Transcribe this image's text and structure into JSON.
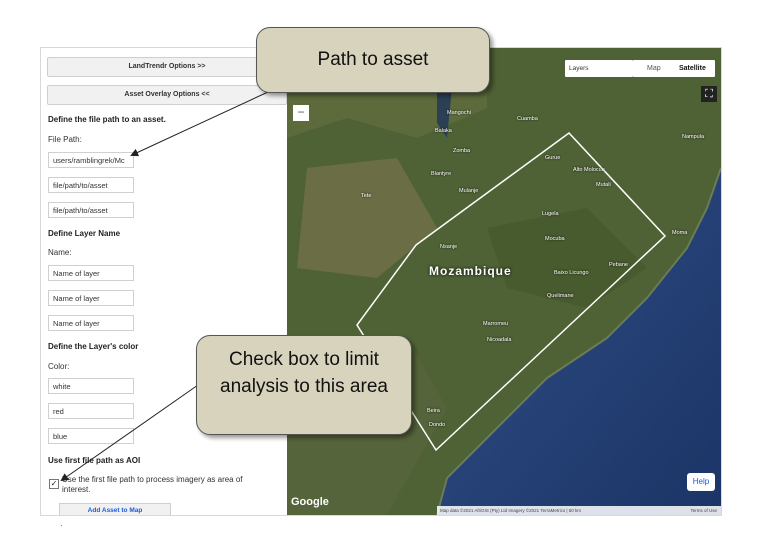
{
  "panel": {
    "landtrendr_button": "LandTrendr Options >>",
    "asset_overlay_button": "Asset Overlay Options <<",
    "file_path_heading": "Define the file path to an asset.",
    "file_path_label": "File Path:",
    "file_paths": [
      "users/ramblingrek/Mc",
      "file/path/to/asset",
      "file/path/to/asset"
    ],
    "layer_name_heading": "Define Layer Name",
    "name_label": "Name:",
    "layer_names": [
      "Name of layer",
      "Name of layer",
      "Name of layer"
    ],
    "color_heading": "Define the Layer's color",
    "color_label": "Color:",
    "colors": [
      "white",
      "red",
      "blue"
    ],
    "aoi_heading": "Use first file path as AOI",
    "aoi_checkbox_label": "Use the first file path to process imagery as area of interest.",
    "aoi_checked": true,
    "add_asset_button": "Add Asset to Map"
  },
  "map": {
    "layers_label": "Layers",
    "map_type_map": "Map",
    "map_type_satellite": "Satellite",
    "zoom_out": "−",
    "fullscreen": "⛶",
    "help": "Help",
    "google": "Google",
    "attribution": "Map data ©2021 AfriGIS (Pty) Ltd Imagery ©2021 TerraMetrics | 50 km",
    "terms": "Terms of Use",
    "country_label": "Mozambique",
    "places": [
      "Cuamba",
      "Mangochi",
      "Balaka",
      "Zomba",
      "Blantyre",
      "Mulanje",
      "Tete",
      "Gurue",
      "Alto Molocue",
      "Mutali",
      "Lugela",
      "Mocuba",
      "Nampula",
      "Moma",
      "Nsanje",
      "Quelimane",
      "Baixo Licungo",
      "Pebane",
      "Marromeu",
      "Nicoadala",
      "Beira",
      "Dondo"
    ]
  },
  "callouts": {
    "path_to_asset": "Path to asset",
    "check_box": "Check box to limit analysis to this area"
  }
}
